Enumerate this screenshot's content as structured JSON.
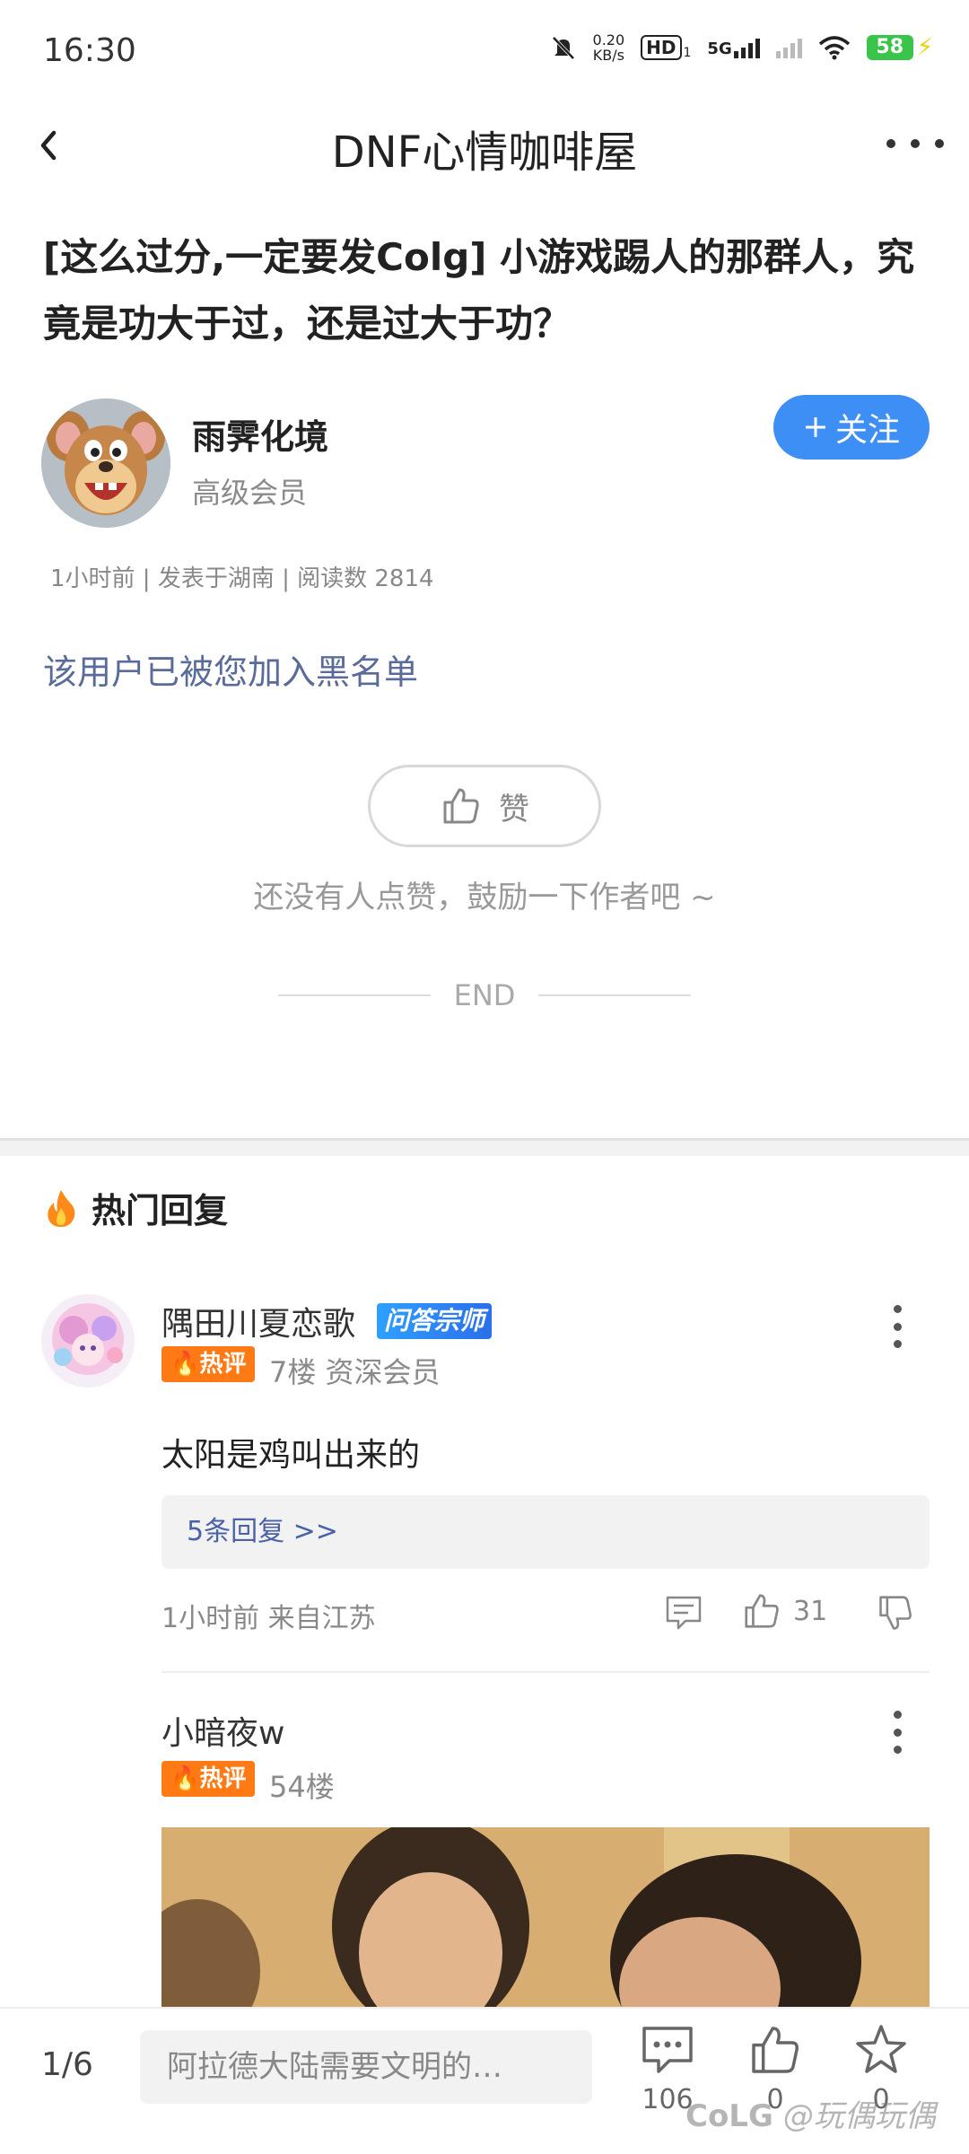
{
  "status_bar": {
    "time": "16:30",
    "net_speed_value": "0.20",
    "net_speed_unit": "KB/s",
    "hd_label": "HD",
    "hd_sub": "1",
    "network_label": "5G",
    "battery": "58"
  },
  "nav": {
    "title": "DNF心情咖啡屋"
  },
  "post": {
    "title": "[这么过分,一定要发Colg] 小游戏踢人的那群人，究竟是功大于过，还是过大于功？",
    "author_name": "雨霁化境",
    "author_level": "高级会员",
    "follow_label": "关注",
    "meta": "1小时前 | 发表于湖南 | 阅读数 2814",
    "blacklist_note": "该用户已被您加入黑名单",
    "like_label": "赞",
    "like_hint": "还没有人点赞，鼓励一下作者吧 ~",
    "end_label": "END"
  },
  "hot_replies": {
    "header": "热门回复",
    "hot_tag": "热评",
    "items": [
      {
        "name": "隅田川夏恋歌",
        "badge": "问答宗师",
        "floor_info": "7楼 资深会员",
        "content": "太阳是鸡叫出来的",
        "sub_replies": "5条回复 >>",
        "time_location": "1小时前 来自江苏",
        "likes": "31"
      },
      {
        "name": "小暗夜w",
        "floor_info": "54楼"
      }
    ]
  },
  "bottom_bar": {
    "page": "1/6",
    "input_placeholder": "阿拉德大陆需要文明的…",
    "comment_count": "106",
    "like_count": "0",
    "fav_count": "0",
    "watermark": "@玩偶玩偶"
  },
  "colors": {
    "accent_blue": "#3d8ef5",
    "hot_orange": "#ff7a14",
    "link_blue": "#4a62a8"
  }
}
